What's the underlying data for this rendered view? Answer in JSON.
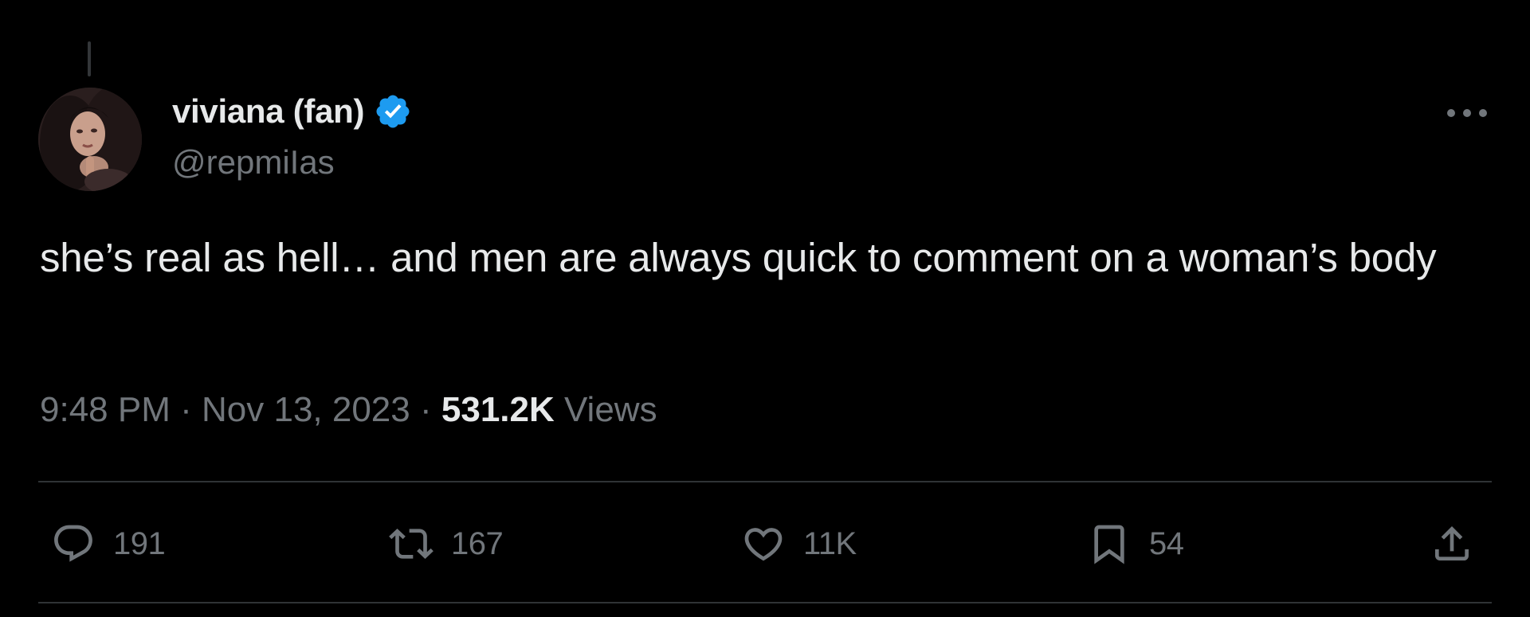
{
  "theme": {
    "background": "#000000",
    "text_primary": "#e7e9ea",
    "text_secondary": "#71767b",
    "divider": "#2f3336",
    "verified_color": "#1d9bf0"
  },
  "author": {
    "display_name": "viviana (fan)",
    "handle": "@repmiIas",
    "verified": true,
    "avatar_icon": "profile-photo"
  },
  "tweet": {
    "text": "she’s real as hell… and men are always quick to comment on a woman’s body",
    "time": "9:48 PM",
    "separator": "·",
    "date": "Nov 13, 2023",
    "views_count": "531.2K",
    "views_label": "Views"
  },
  "actions": {
    "reply": {
      "icon": "reply-icon",
      "count": "191"
    },
    "retweet": {
      "icon": "retweet-icon",
      "count": "167"
    },
    "like": {
      "icon": "heart-icon",
      "count": "11K"
    },
    "bookmark": {
      "icon": "bookmark-icon",
      "count": "54"
    },
    "share": {
      "icon": "share-icon"
    }
  },
  "menu": {
    "icon": "more-icon"
  }
}
